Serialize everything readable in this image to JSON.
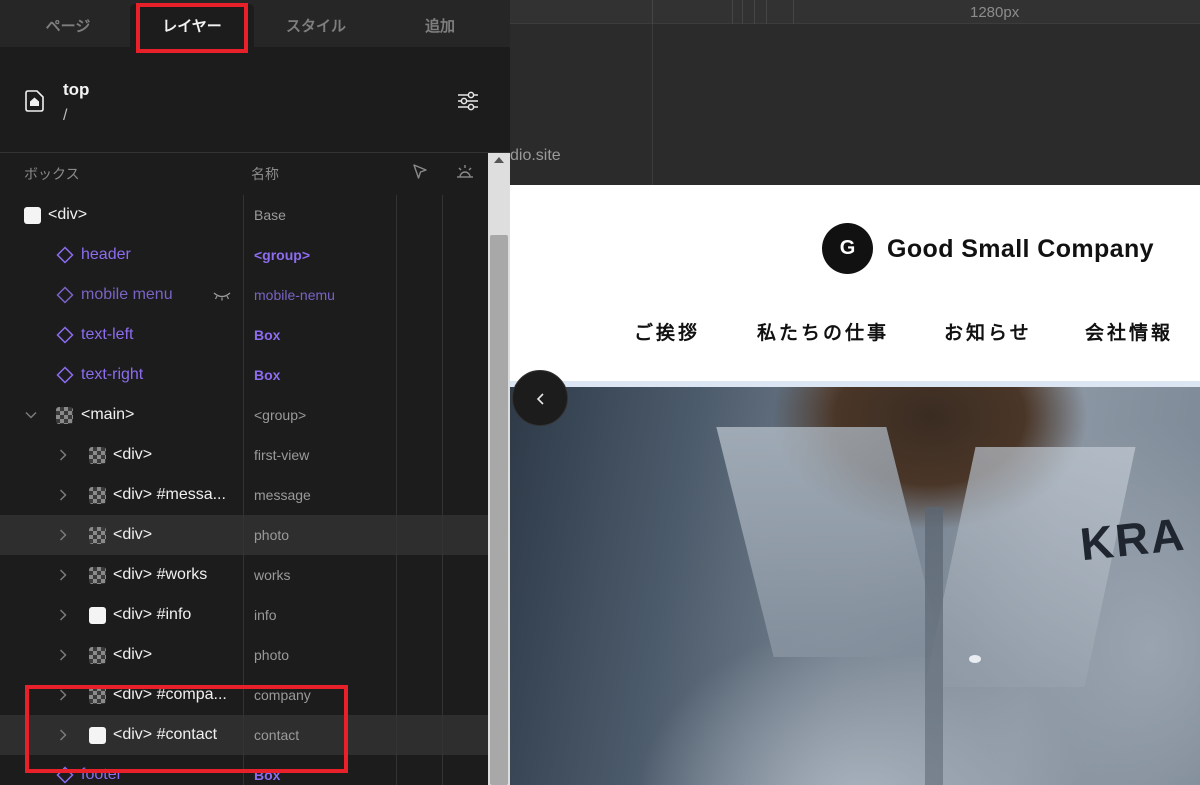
{
  "tabs": [
    {
      "label": "ページ",
      "active": false
    },
    {
      "label": "レイヤー",
      "active": true
    },
    {
      "label": "スタイル",
      "active": false
    },
    {
      "label": "追加",
      "active": false
    }
  ],
  "page": {
    "name": "top",
    "path": "/",
    "icon": "home-icon"
  },
  "columns": {
    "box": "ボックス",
    "name": "名称",
    "select_icon": "pointer-icon",
    "visibility_icon": "sunrise-icon"
  },
  "layers": [
    {
      "label": "<div>",
      "name": "Base",
      "icon": "white-square",
      "expand": "none"
    },
    {
      "label": "header",
      "name": "<group>",
      "icon": "diamond-icon",
      "expand": "none"
    },
    {
      "label": "mobile menu",
      "name": "mobile-nemu",
      "icon": "diamond-icon",
      "expand": "none",
      "hidden": true
    },
    {
      "label": "text-left",
      "name": "Box",
      "icon": "diamond-icon",
      "expand": "none"
    },
    {
      "label": "text-right",
      "name": "Box",
      "icon": "diamond-icon",
      "expand": "none"
    },
    {
      "label": "<main>",
      "name": "<group>",
      "icon": "checker-square",
      "expand": "expanded"
    },
    {
      "label": "<div>",
      "name": "first-view",
      "icon": "checker-square",
      "expand": "collapsed"
    },
    {
      "label": "<div> #messa...",
      "name": "message",
      "icon": "checker-square",
      "expand": "collapsed"
    },
    {
      "label": "<div>",
      "name": "photo",
      "icon": "checker-square",
      "expand": "collapsed",
      "highlighted": true
    },
    {
      "label": "<div> #works",
      "name": "works",
      "icon": "checker-square",
      "expand": "collapsed"
    },
    {
      "label": "<div> #info",
      "name": "info",
      "icon": "white-square",
      "expand": "collapsed"
    },
    {
      "label": "<div>",
      "name": "photo",
      "icon": "checker-square",
      "expand": "collapsed"
    },
    {
      "label": "<div> #compa...",
      "name": "company",
      "icon": "checker-square",
      "expand": "collapsed"
    },
    {
      "label": "<div> #contact",
      "name": "contact",
      "icon": "white-square",
      "expand": "collapsed",
      "highlighted": true
    },
    {
      "label": "footer",
      "name": "Box",
      "icon": "diamond-icon",
      "expand": "none"
    }
  ],
  "canvas": {
    "ruler_label": "1280px",
    "url_text": "dio.site"
  },
  "site": {
    "logo_letter": "G",
    "brand": "Good Small Company",
    "nav": [
      "ご挨拶",
      "私たちの仕事",
      "お知らせ",
      "会社情報"
    ],
    "hero_text": "KRA"
  },
  "colors": {
    "accent_purple": "#8d6cf0",
    "highlight_red": "#e8202a",
    "panel_bg": "#1c1c1c"
  }
}
